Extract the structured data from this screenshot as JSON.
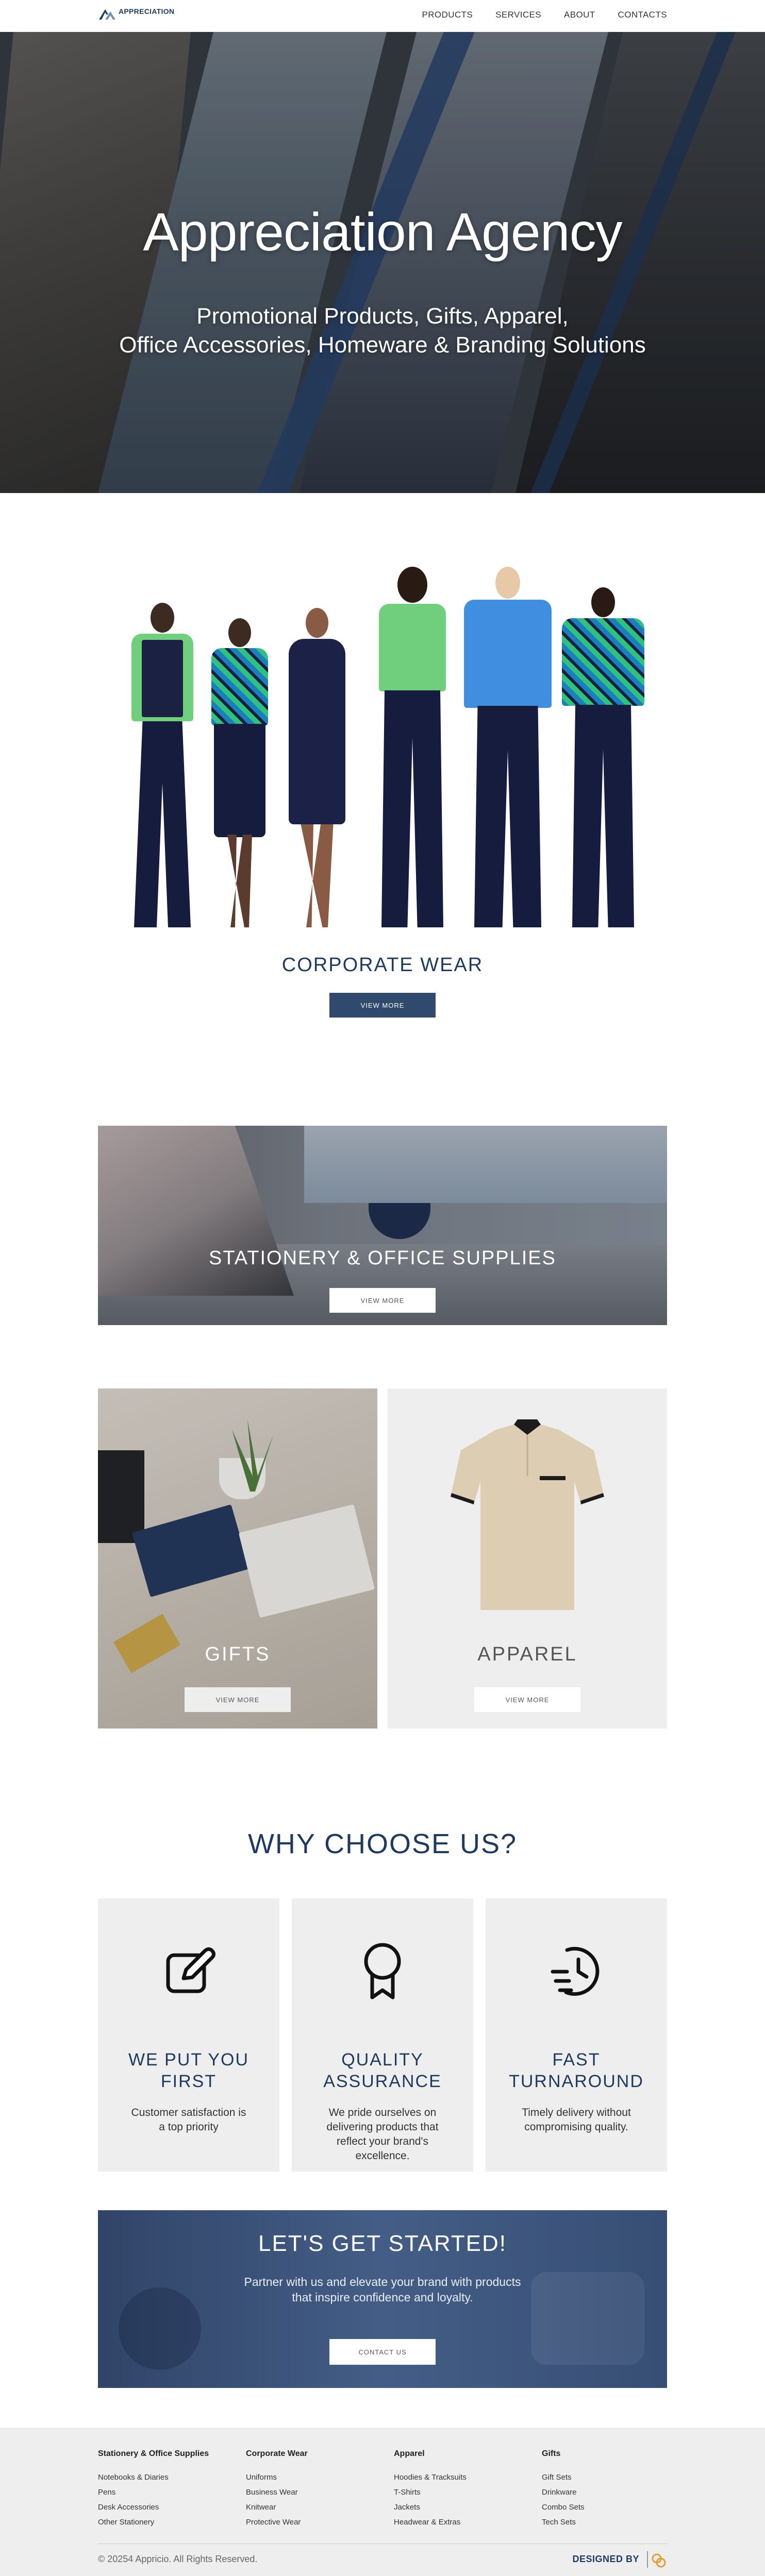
{
  "nav": {
    "logo_text": "APPRECIATION",
    "logo_sub": "",
    "links": [
      "PRODUCTS",
      "SERVICES",
      "ABOUT",
      "CONTACTS"
    ]
  },
  "hero": {
    "title": "Appreciation Agency",
    "subtitle_line1": "Promotional Products, Gifts, Apparel,",
    "subtitle_line2": "Office Accessories, Homeware & Branding Solutions"
  },
  "corporate_wear": {
    "title": "CORPORATE WEAR",
    "button": "VIEW MORE"
  },
  "stationery": {
    "title": "STATIONERY & OFFICE SUPPLIES",
    "button": "VIEW MORE"
  },
  "gifts": {
    "title": "GIFTS",
    "button": "VIEW MORE"
  },
  "apparel": {
    "title": "APPAREL",
    "button": "VIEW MORE"
  },
  "why": {
    "title": "WHY CHOOSE US?",
    "features": [
      {
        "icon": "edit-icon",
        "title_line1": "WE PUT YOU",
        "title_line2": "FIRST",
        "text": "Customer satisfaction is a top priority"
      },
      {
        "icon": "award-ribbon-icon",
        "title_line1": "QUALITY",
        "title_line2": "ASSURANCE",
        "text": "We pride ourselves on delivering products that reflect your brand's excellence."
      },
      {
        "icon": "fast-clock-icon",
        "title_line1": "FAST",
        "title_line2": "TURNAROUND",
        "text": "Timely delivery without compromising quality."
      }
    ]
  },
  "cta": {
    "title": "LET'S GET STARTED!",
    "text_line1": "Partner with us and elevate your brand with products",
    "text_line2": "that inspire confidence and loyalty.",
    "button": "CONTACT US"
  },
  "footer": {
    "columns": [
      {
        "heading": "Stationery & Office Supplies",
        "links": [
          "Notebooks & Diaries",
          "Pens",
          "Desk Accessories",
          "Other Stationery"
        ]
      },
      {
        "heading": "Corporate Wear",
        "links": [
          "Uniforms",
          "Business Wear",
          "Knitwear",
          "Protective Wear"
        ]
      },
      {
        "heading": "Apparel",
        "links": [
          "Hoodies & Tracksuits",
          "T-Shirts",
          "Jackets",
          "Headwear & Extras"
        ]
      },
      {
        "heading": "Gifts",
        "links": [
          "Gift Sets",
          "Drinkware",
          "Combo Sets",
          "Tech Sets"
        ]
      }
    ],
    "copyright": "© 20254 Appricio. All Rights Reserved.",
    "designed_by": "DESIGNED BY"
  },
  "colors": {
    "brand_navy": "#1f3a5f",
    "button_navy": "#2f4a6d",
    "panel_grey": "#eeeeee",
    "cta_blue": "#47618a"
  }
}
